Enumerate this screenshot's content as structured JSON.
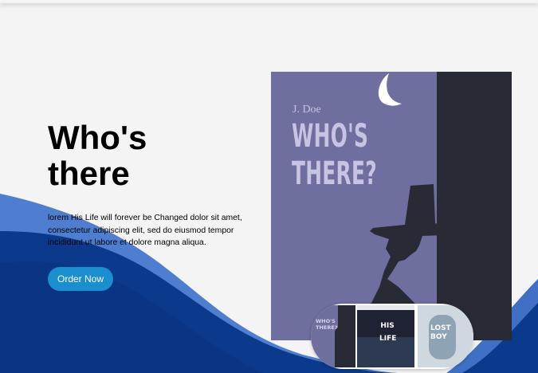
{
  "hero": {
    "title_line1": "Who's",
    "title_line2": "there",
    "description": "lorem His Life will forever be Changed dolor sit amet, consectetur adipiscing elit, sed do eiusmod tempor incididunt ut labore et dolore magna aliqua.",
    "order_button": "Order Now"
  },
  "book": {
    "author": "J. Doe",
    "title": "WHO'S THERE?"
  },
  "carousel": {
    "items": [
      {
        "label": "WHO'S THERE?"
      },
      {
        "label": "HIS LIFE"
      },
      {
        "label": "LOST BOY"
      }
    ]
  },
  "colors": {
    "accent": "#1a8fd0",
    "wave_dark": "#0b3a8c",
    "wave_light": "#3f70c5",
    "cover_purple": "#6e6e9f",
    "cover_dark": "#282a36"
  }
}
